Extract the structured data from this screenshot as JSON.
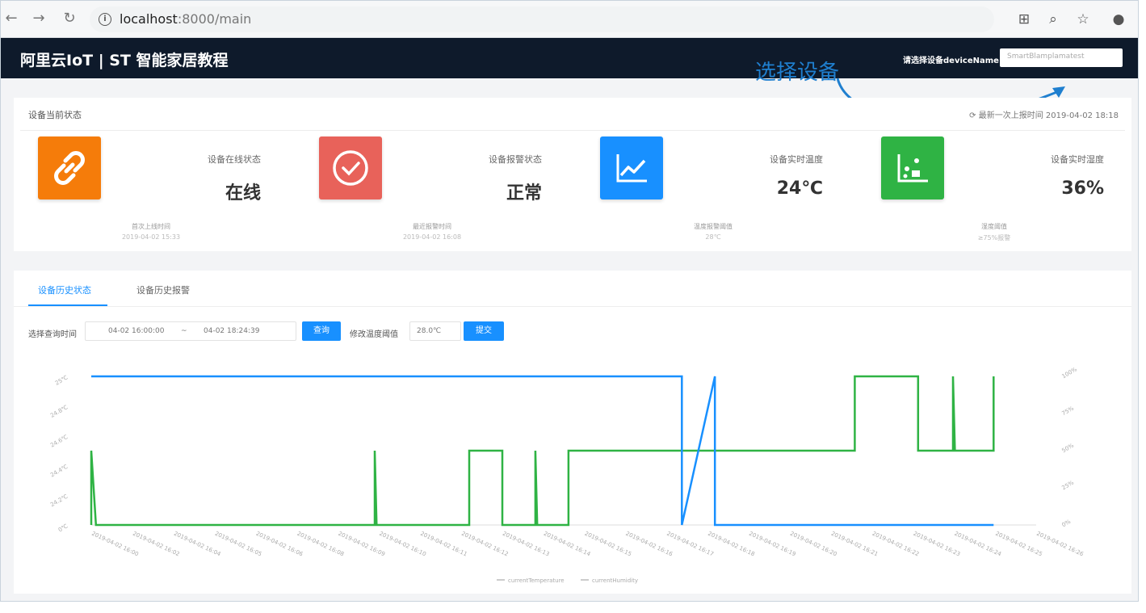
{
  "browser": {
    "url_host": "localhost",
    "url_rest": ":8000/main"
  },
  "app": {
    "title": "阿里云IoT | ST 智能家居教程",
    "device_label": "请选择设备deviceName:",
    "device_value": "SmartBlamplamatest"
  },
  "annotation": {
    "text": "选择设备"
  },
  "status": {
    "title": "设备当前状态",
    "refresh": "最新一次上报时间 2019-04-02 18:18",
    "metrics": [
      {
        "label": "设备在线状态",
        "value": "在线",
        "sub1": "首次上线时间",
        "sub2": "2019-04-02 15:33",
        "color": "#f57c0a",
        "icon": "link-icon"
      },
      {
        "label": "设备报警状态",
        "value": "正常",
        "sub1": "最近报警时间",
        "sub2": "2019-04-02 16:08",
        "color": "#e8625a",
        "icon": "check-circle-icon"
      },
      {
        "label": "设备实时温度",
        "value": "24℃",
        "sub1": "温度报警阈值",
        "sub2": "28℃",
        "color": "#1890ff",
        "icon": "line-chart-icon"
      },
      {
        "label": "设备实时湿度",
        "value": "36%",
        "sub1": "湿度阈值",
        "sub2": "≥75%报警",
        "color": "#2fb344",
        "icon": "dot-chart-icon"
      }
    ]
  },
  "history": {
    "tabs": [
      {
        "label": "设备历史状态",
        "active": true
      },
      {
        "label": "设备历史报警",
        "active": false
      }
    ],
    "filter": {
      "time_label": "选择查询时间",
      "start": "04-02 16:00:00",
      "sep": "~",
      "end": "04-02 18:24:39",
      "query_button": "查询",
      "threshold_label": "修改温度阈值",
      "threshold_value": "28.0℃",
      "submit_button": "提交"
    }
  },
  "chart_data": {
    "type": "line",
    "left_axis_ticks": [
      "0℃",
      "24.2℃",
      "24.4℃",
      "24.6℃",
      "24.8℃",
      "25℃"
    ],
    "right_axis_ticks": [
      "0%",
      "25%",
      "50%",
      "75%",
      "100%"
    ],
    "x": [
      "2019-04-02 16:00",
      "2019-04-02 16:02",
      "2019-04-02 16:04",
      "2019-04-02 16:05",
      "2019-04-02 16:06",
      "2019-04-02 16:08",
      "2019-04-02 16:09",
      "2019-04-02 16:10",
      "2019-04-02 16:11",
      "2019-04-02 16:12",
      "2019-04-02 16:13",
      "2019-04-02 16:14",
      "2019-04-02 16:15",
      "2019-04-02 16:16",
      "2019-04-02 16:17",
      "2019-04-02 16:18",
      "2019-04-02 16:19",
      "2019-04-02 16:20",
      "2019-04-02 16:21",
      "2019-04-02 16:22",
      "2019-04-02 16:23",
      "2019-04-02 16:24",
      "2019-04-02 16:25",
      "2019-04-02 16:26"
    ],
    "series": [
      {
        "name": "currentTemperature",
        "color": "#2fb344",
        "steps": [
          [
            0,
            24.0
          ],
          [
            0,
            24.5
          ],
          [
            0.5,
            24.0
          ],
          [
            30,
            24.0
          ],
          [
            30,
            24.5
          ],
          [
            30.2,
            24.0
          ],
          [
            40,
            24.0
          ],
          [
            40,
            24.5
          ],
          [
            43.5,
            24.5
          ],
          [
            43.5,
            24.0
          ],
          [
            47,
            24.0
          ],
          [
            47,
            24.5
          ],
          [
            47.2,
            24.0
          ],
          [
            50.5,
            24.0
          ],
          [
            50.5,
            24.5
          ],
          [
            80.8,
            24.5
          ],
          [
            80.8,
            25.0
          ],
          [
            87.5,
            25.0
          ],
          [
            87.5,
            24.5
          ],
          [
            91.2,
            24.5
          ],
          [
            91.2,
            25.0
          ],
          [
            91.4,
            24.5
          ],
          [
            95.5,
            24.5
          ],
          [
            95.5,
            25.0
          ]
        ]
      },
      {
        "name": "currentHumidity",
        "color": "#1890ff",
        "steps": [
          [
            0,
            100
          ],
          [
            62.5,
            100
          ],
          [
            62.5,
            0
          ],
          [
            66,
            100
          ],
          [
            66,
            0
          ],
          [
            95.5,
            0
          ]
        ]
      }
    ],
    "legend": [
      "currentTemperature",
      "currentHumidity"
    ]
  }
}
